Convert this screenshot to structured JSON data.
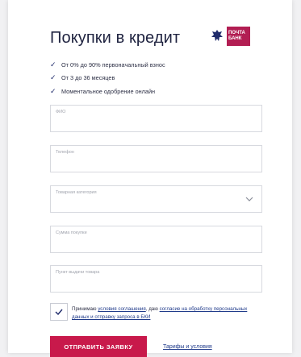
{
  "colors": {
    "brand": "#c8194b",
    "link": "#1f3a8a",
    "check": "#1f2b6b"
  },
  "header": {
    "title": "Покупки в кредит",
    "logo_text_line1": "ПОЧТА",
    "logo_text_line2": "БАНК"
  },
  "benefits": [
    {
      "icon": "checkmark-icon",
      "text": "От 0% до 90% первоначальный взнос"
    },
    {
      "icon": "checkmark-icon",
      "text": "От 3 до 36 месяцев"
    },
    {
      "icon": "checkmark-icon",
      "text": "Моментальное одобрение онлайн"
    }
  ],
  "fields": {
    "fio": {
      "label": "ФИО",
      "value": ""
    },
    "phone": {
      "label": "Телефон",
      "value": ""
    },
    "category": {
      "label": "Товарная категория",
      "value": ""
    },
    "amount": {
      "label": "Сумма покупки",
      "value": ""
    },
    "pickup": {
      "label": "Пункт выдачи товара",
      "value": ""
    }
  },
  "consent": {
    "checked": true,
    "prefix": "Принимаю ",
    "link1": "условия соглашения",
    "middle": ", даю ",
    "link2": "согласие на обработку персональных данных и отправку запроса в БКИ"
  },
  "actions": {
    "submit_label": "ОТПРАВИТЬ ЗАЯВКУ",
    "tariffs_label": "Тарифы и условия"
  }
}
